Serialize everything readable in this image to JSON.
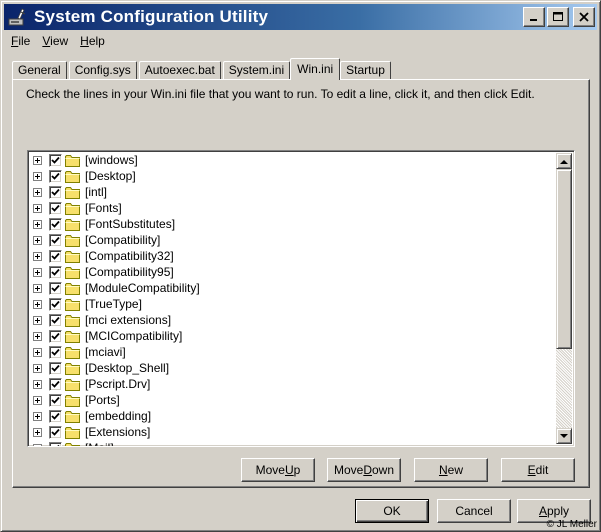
{
  "window": {
    "title": "System Configuration Utility"
  },
  "menu": [
    {
      "label": "File",
      "mnemonic": "F",
      "rest": "ile"
    },
    {
      "label": "View",
      "mnemonic": "V",
      "rest": "iew"
    },
    {
      "label": "Help",
      "mnemonic": "H",
      "rest": "elp"
    }
  ],
  "tabs": [
    "General",
    "Config.sys",
    "Autoexec.bat",
    "System.ini",
    "Win.ini",
    "Startup"
  ],
  "active_tab": "Win.ini",
  "instructions": "Check the lines in your Win.ini file that you want to run. To edit a line, click it, and then click Edit.",
  "sections": [
    {
      "label": "[windows]",
      "checked": true
    },
    {
      "label": "[Desktop]",
      "checked": true
    },
    {
      "label": "[intl]",
      "checked": true
    },
    {
      "label": "[Fonts]",
      "checked": true
    },
    {
      "label": "[FontSubstitutes]",
      "checked": true
    },
    {
      "label": "[Compatibility]",
      "checked": true
    },
    {
      "label": "[Compatibility32]",
      "checked": true
    },
    {
      "label": "[Compatibility95]",
      "checked": true
    },
    {
      "label": "[ModuleCompatibility]",
      "checked": true
    },
    {
      "label": "[TrueType]",
      "checked": true
    },
    {
      "label": "[mci extensions]",
      "checked": true
    },
    {
      "label": "[MCICompatibility]",
      "checked": true
    },
    {
      "label": "[mciavi]",
      "checked": true
    },
    {
      "label": "[Desktop_Shell]",
      "checked": true
    },
    {
      "label": "[Pscript.Drv]",
      "checked": true
    },
    {
      "label": "[Ports]",
      "checked": true
    },
    {
      "label": "[embedding]",
      "checked": true
    },
    {
      "label": "[Extensions]",
      "checked": true
    },
    {
      "label": "[Mail]",
      "checked": true
    }
  ],
  "list_buttons": {
    "move_up": {
      "label": "Move Up",
      "pre": "Move ",
      "mn": "U",
      "post": "p"
    },
    "move_down": {
      "label": "Move Down",
      "pre": "Move ",
      "mn": "D",
      "post": "own"
    },
    "new": {
      "label": "New",
      "pre": "",
      "mn": "N",
      "post": "ew"
    },
    "edit": {
      "label": "Edit",
      "pre": "",
      "mn": "E",
      "post": "dit"
    }
  },
  "dialog_buttons": {
    "ok": "OK",
    "cancel": "Cancel",
    "apply": {
      "label": "Apply",
      "pre": "",
      "mn": "A",
      "post": "pply"
    }
  },
  "copyright": "© JL Meller",
  "colors": {
    "titlebar_start": "#0a246a",
    "titlebar_end": "#a6caf0",
    "face": "#d4d0c8",
    "folder": "#f7e06b"
  }
}
